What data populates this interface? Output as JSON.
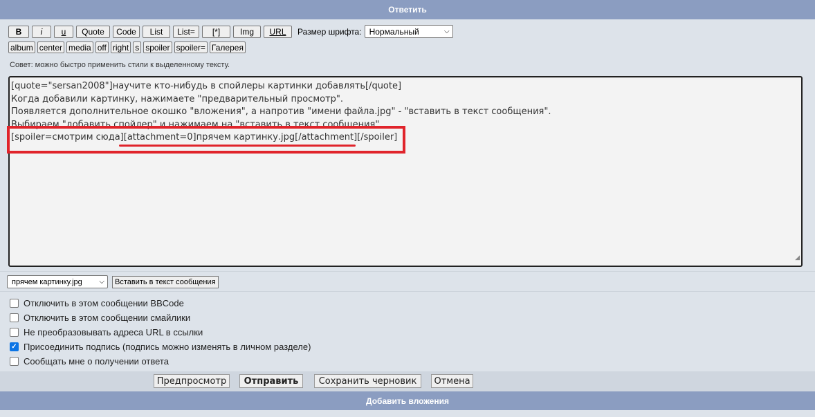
{
  "header": {
    "title": "Ответить"
  },
  "toolbar": {
    "row1": [
      "B",
      "i",
      "u",
      "Quote",
      "Code",
      "List",
      "List=",
      "[*]",
      "Img",
      "URL"
    ],
    "row2": [
      "album",
      "center",
      "media",
      "off",
      "right",
      "s",
      "spoiler",
      "spoiler=",
      "Галерея"
    ],
    "font_size_label": "Размер шрифта:",
    "font_size_value": "Нормальный"
  },
  "hint": "Совет: можно быстро применить стили к выделенному тексту.",
  "message": {
    "lines": [
      "[quote=\"sersan2008\"]научите кто-нибудь в спойлеры картинки добавлять[/quote]",
      "Когда добавили картинку, нажимаете \"предварительный просмотр\".",
      "Появляется дополнительное окошко \"вложения\", а напротив \"имени файла.jpg\" - \"вставить в текст сообщения\".",
      "Выбираем \"добавить спойлер\" и нажимаем на \"вставить в текст сообщения\"",
      "[spoiler=смотрим сюда][attachment=0]прячем картинку.jpg[/attachment][/spoiler]"
    ]
  },
  "attachment": {
    "selected_file": "прячем картинку.jpg",
    "insert_label": "Вставить в текст сообщения"
  },
  "options": [
    {
      "label": "Отключить в этом сообщении BBCode",
      "checked": false
    },
    {
      "label": "Отключить в этом сообщении смайлики",
      "checked": false
    },
    {
      "label": "Не преобразовывать адреса URL в ссылки",
      "checked": false
    },
    {
      "label": "Присоединить подпись (подпись можно изменять в личном разделе)",
      "checked": true
    },
    {
      "label": "Сообщать мне о получении ответа",
      "checked": false
    }
  ],
  "actions": {
    "preview": "Предпросмотр",
    "submit": "Отправить",
    "save_draft": "Сохранить черновик",
    "cancel": "Отмена"
  },
  "footer": {
    "title": "Добавить вложения"
  },
  "colors": {
    "header_bg": "#8b9dc1",
    "highlight": "#e0242b",
    "checkbox_accent": "#0b74e5"
  }
}
